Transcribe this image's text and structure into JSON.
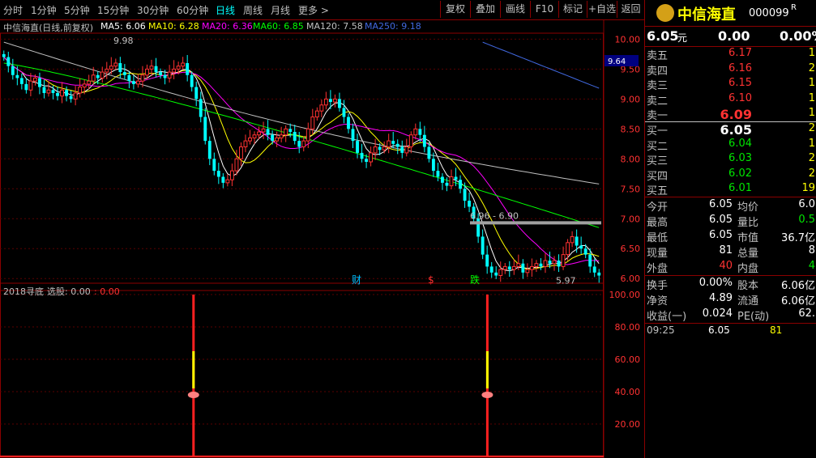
{
  "toolbar": {
    "timeframes": [
      "分时",
      "1分钟",
      "5分钟",
      "15分钟",
      "30分钟",
      "60分钟",
      "日线",
      "周线",
      "月线",
      "更多 >"
    ],
    "active": "日线",
    "buttons": [
      "复权",
      "叠加",
      "画线",
      "F10",
      "标记",
      "+自选",
      "返回"
    ]
  },
  "main": {
    "stock_title": "中信海直(日线,前复权)",
    "ma_labels": [
      {
        "text": "MA5: 6.06",
        "color": "#ffffff"
      },
      {
        "text": "MA10: 6.28",
        "color": "#ffff00"
      },
      {
        "text": "MA20: 6.36",
        "color": "#ff00ff"
      },
      {
        "text": "MA60: 6.85",
        "color": "#00ff00"
      },
      {
        "text": "MA120: 7.58",
        "color": "#c0c0c0"
      },
      {
        "text": "MA250: 9.18",
        "color": "#4169e1"
      }
    ],
    "y_ticks": [
      "10.00",
      "9.50",
      "9.00",
      "8.50",
      "8.00",
      "7.50",
      "7.00",
      "6.50",
      "6.00"
    ],
    "price_tag": "9.64",
    "high_label": "9.98",
    "low_label": "5.97",
    "range_label": "6.96 - 6.90",
    "markers": [
      {
        "text": "财",
        "color": "#00bfff"
      },
      {
        "text": "$",
        "color": "#ff3232"
      },
      {
        "text": "跌",
        "color": "#00ff00"
      }
    ]
  },
  "indicator": {
    "name": "2018寻底",
    "select_label": "选股: 0.00",
    "select_value": ": 0.00",
    "y_ticks": [
      "100.00",
      "80.00",
      "60.00",
      "40.00",
      "20.00"
    ]
  },
  "quote": {
    "name": "中信海直",
    "code": "000099",
    "price": "6.05",
    "unit": "元",
    "change": "0.00",
    "change_pct": "0.00%",
    "asks": [
      {
        "label": "卖五",
        "price": "6.17",
        "vol": "1"
      },
      {
        "label": "卖四",
        "price": "6.16",
        "vol": "2"
      },
      {
        "label": "卖三",
        "price": "6.15",
        "vol": "1"
      },
      {
        "label": "卖二",
        "price": "6.10",
        "vol": "1"
      },
      {
        "label": "卖一",
        "price": "6.09",
        "vol": "1"
      }
    ],
    "bids": [
      {
        "label": "买一",
        "price": "6.05",
        "vol": "2"
      },
      {
        "label": "买二",
        "price": "6.04",
        "vol": "1"
      },
      {
        "label": "买三",
        "price": "6.03",
        "vol": "2"
      },
      {
        "label": "买四",
        "price": "6.02",
        "vol": "2"
      },
      {
        "label": "买五",
        "price": "6.01",
        "vol": "19"
      }
    ],
    "stats": [
      {
        "l1": "今开",
        "v1": "6.05",
        "c1": "white",
        "l2": "均价",
        "v2": "6.0",
        "c2": "white"
      },
      {
        "l1": "最高",
        "v1": "6.05",
        "c1": "white",
        "l2": "量比",
        "v2": "0.5",
        "c2": "green"
      },
      {
        "l1": "最低",
        "v1": "6.05",
        "c1": "white",
        "l2": "市值",
        "v2": "36.7亿",
        "c2": "white"
      },
      {
        "l1": "现量",
        "v1": "81",
        "c1": "white",
        "l2": "总量",
        "v2": "8",
        "c2": "white"
      },
      {
        "l1": "外盘",
        "v1": "40",
        "c1": "red",
        "l2": "内盘",
        "v2": "4",
        "c2": "green"
      }
    ],
    "fund": [
      {
        "l1": "换手",
        "v1": "0.00%",
        "l2": "股本",
        "v2": "6.06亿"
      },
      {
        "l1": "净资",
        "v1": "4.89",
        "l2": "流通",
        "v2": "6.06亿"
      },
      {
        "l1": "收益(一)",
        "v1": "0.024",
        "l2": "PE(动)",
        "v2": "62."
      }
    ],
    "trade": {
      "time": "09:25",
      "price": "6.05",
      "vol": "81"
    }
  },
  "chart_data": [
    {
      "type": "line",
      "title": "中信海直(日线,前复权)",
      "ylim": [
        5.8,
        10.1
      ],
      "close": [
        9.7,
        9.55,
        9.4,
        9.35,
        9.25,
        9.15,
        9.3,
        9.35,
        9.2,
        9.1,
        9.15,
        9.1,
        9.05,
        9.15,
        9.05,
        9.0,
        9.1,
        9.2,
        9.25,
        9.3,
        9.4,
        9.35,
        9.45,
        9.5,
        9.55,
        9.6,
        9.45,
        9.4,
        9.3,
        9.25,
        9.3,
        9.4,
        9.5,
        9.55,
        9.45,
        9.4,
        9.35,
        9.45,
        9.5,
        9.55,
        9.6,
        9.4,
        9.2,
        9.0,
        8.7,
        8.3,
        8.0,
        7.8,
        7.7,
        7.6,
        7.65,
        7.8,
        8.0,
        8.2,
        8.3,
        8.35,
        8.4,
        8.45,
        8.5,
        8.4,
        8.3,
        8.35,
        8.4,
        8.5,
        8.45,
        8.3,
        8.2,
        8.3,
        8.5,
        8.7,
        8.8,
        8.9,
        9.0,
        8.95,
        9.0,
        8.85,
        8.7,
        8.5,
        8.3,
        8.1,
        8.0,
        7.95,
        8.1,
        8.2,
        8.15,
        8.2,
        8.3,
        8.25,
        8.2,
        8.1,
        8.2,
        8.4,
        8.5,
        8.4,
        8.2,
        8.0,
        7.8,
        7.7,
        7.6,
        7.55,
        7.7,
        7.65,
        7.5,
        7.3,
        7.2,
        7.0,
        6.7,
        6.4,
        6.2,
        6.1,
        6.05,
        6.15,
        6.2,
        6.15,
        6.2,
        6.25,
        6.1,
        6.15,
        6.2,
        6.25,
        6.2,
        6.3,
        6.25,
        6.3,
        6.2,
        6.4,
        6.6,
        6.7,
        6.55,
        6.5,
        6.4,
        6.2,
        6.1,
        6.05
      ],
      "ma60_end": 6.85,
      "ma120_end": 7.58,
      "ma250_end": 9.18
    },
    {
      "type": "bar",
      "title": "2018寻底",
      "ylim": [
        0,
        100
      ],
      "signals": [
        {
          "position": 0.32,
          "value": 100
        },
        {
          "position": 0.81,
          "value": 100
        }
      ]
    }
  ]
}
